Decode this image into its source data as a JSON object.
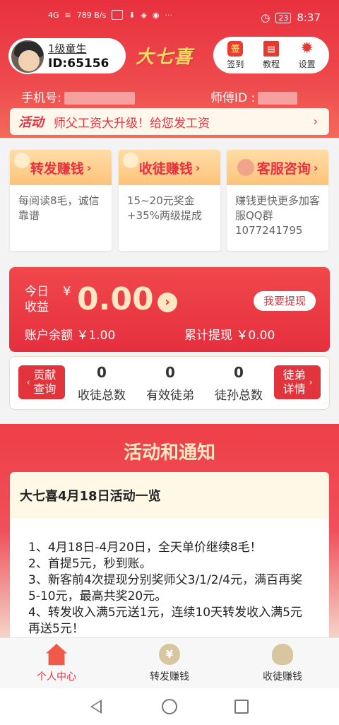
{
  "status_bar": {
    "network": "4G",
    "speed": "789 B/s",
    "battery": "23",
    "time": "8:37"
  },
  "profile": {
    "level": "1级童生",
    "id": "ID:65156"
  },
  "brand": "大七喜",
  "actions": [
    {
      "label": "签到",
      "icon": "sign-in-icon"
    },
    {
      "label": "教程",
      "icon": "book-icon"
    },
    {
      "label": "设置",
      "icon": "gear-icon"
    }
  ],
  "info": {
    "phone_label": "手机号:",
    "master_label": "师傅ID :"
  },
  "notice": {
    "tag": "活动",
    "text": "师父工资大升级！给您发工资"
  },
  "cards": [
    {
      "title": "转发赚钱",
      "body": "每阅读8毛，诚信靠谱"
    },
    {
      "title": "收徒赚钱",
      "body": "15~20元奖金+35%两级提成"
    },
    {
      "title": "客服咨询",
      "body": "赚钱更快更多加客服QQ群1077241795"
    }
  ],
  "earnings": {
    "today_label": "今日收益",
    "currency": "¥",
    "today_value": "0.00",
    "withdraw_label": "我要提现",
    "balance_text": "账户余额 ￥1.00",
    "total_text": "累计提现 ￥0.00"
  },
  "stats": {
    "left_button": "贡献查询",
    "right_button": "徒弟详情",
    "items": [
      {
        "value": "0",
        "label": "收徒总数"
      },
      {
        "value": "0",
        "label": "有效徒弟"
      },
      {
        "value": "0",
        "label": "徒孙总数"
      }
    ]
  },
  "activity": {
    "section_title": "活动和通知",
    "card_title": "大七喜4月18日活动一览",
    "lines": [
      "1、4月18日-4月20日，全天单价继续8毛！",
      "2、首提5元，秒到账。",
      "3、新客前4次提现分别奖师父3/1/2/4元，满百再奖5-10元，最高共奖20元。",
      "4、转发收入满5元送1元，连续10天转发收入满5元再送5元！"
    ]
  },
  "tabs": [
    {
      "label": "个人中心",
      "active": true
    },
    {
      "label": "转发赚钱",
      "active": false
    },
    {
      "label": "收徒赚钱",
      "active": false
    }
  ],
  "colors": {
    "primary": "#e8303f",
    "gold": "#ffd86a",
    "cream": "#ffe7c4"
  }
}
